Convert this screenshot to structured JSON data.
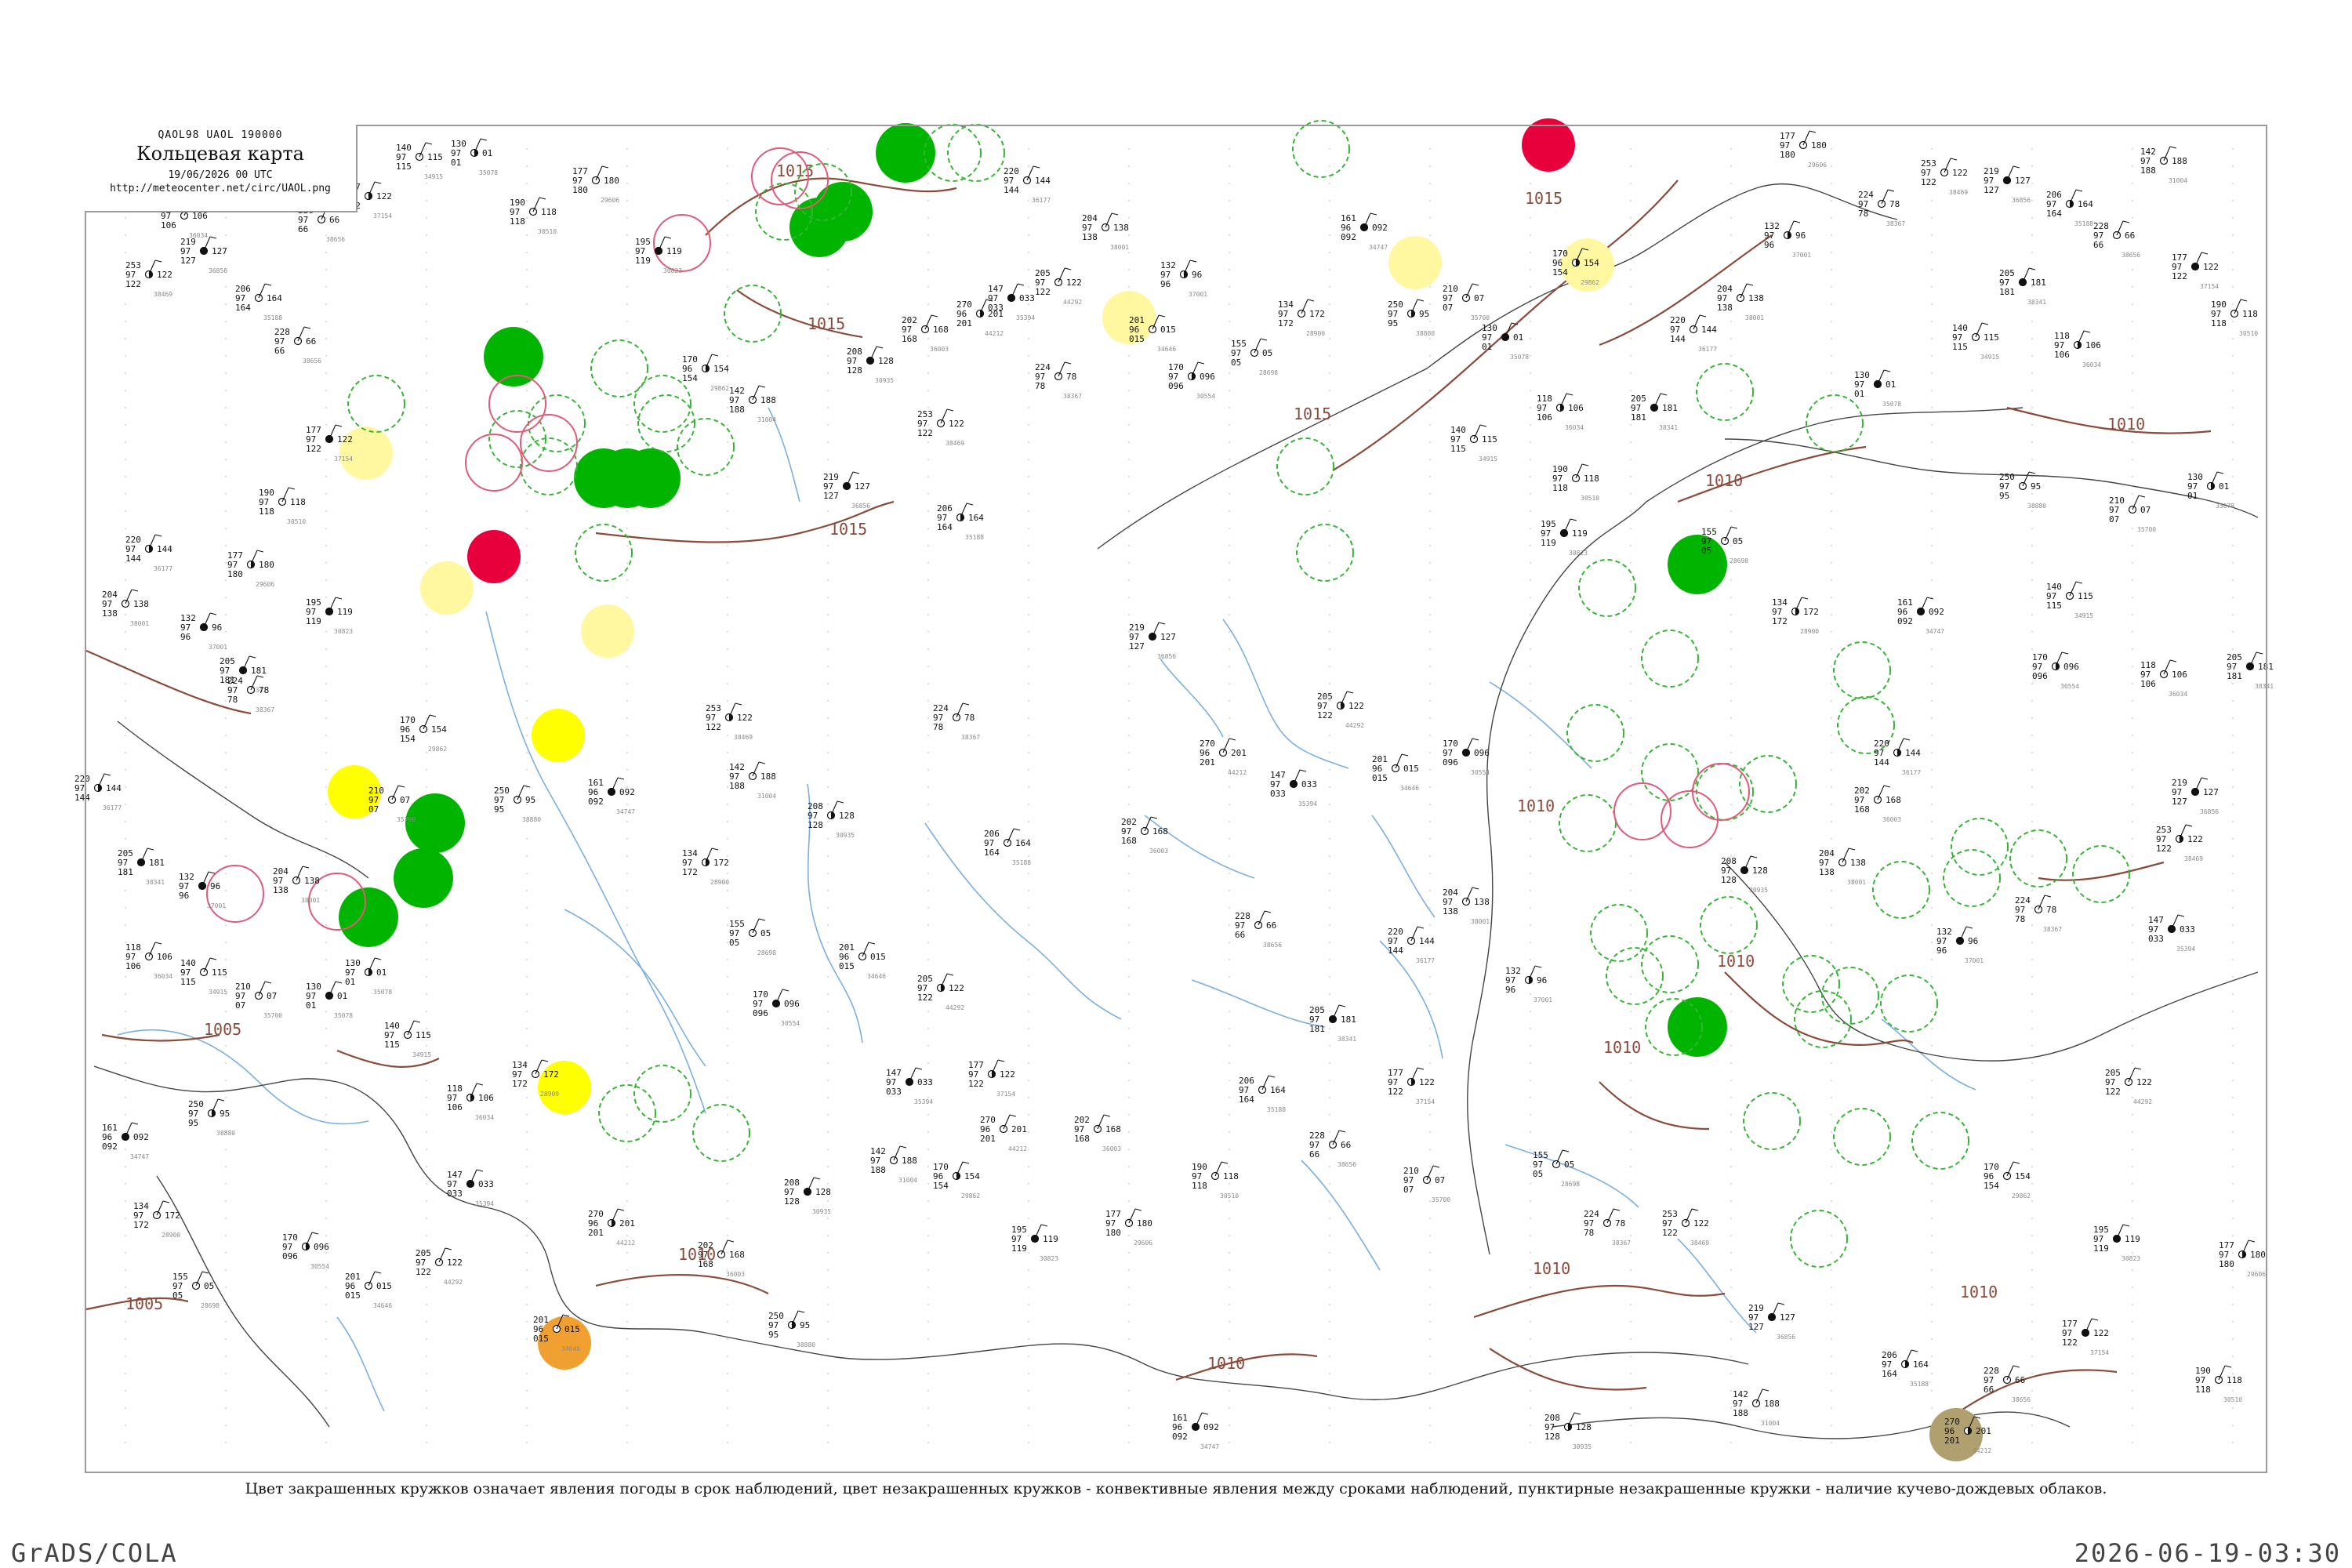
{
  "header": {
    "code_line": "QAOL98  UAOL  190000",
    "title": "Кольцевая карта",
    "datetime": "19/06/2026 00 UTC",
    "url": "http://meteocenter.net/circ/UAOL.png"
  },
  "caption": "Цвет закрашенных кружков означает явления погоды в срок наблюдений, цвет незакрашенных кружков - конвективные явления между сроками наблюдений, пунктирные незакрашенные кружки - наличие кучево-дождевых облаков.",
  "footer": {
    "left": "GrADS/COLA",
    "right": "2026-06-19-03:30"
  },
  "colors": {
    "rain": "#00b400",
    "thunder": "#e8003c",
    "haze": "#ffff00",
    "light_haze": "#fff8a0",
    "dust": "#f0a030",
    "fog": "#b0a070",
    "cb_dashed": "#34b534",
    "conv_open": "#e05a7a",
    "isobar": "#8b4a3a",
    "river": "#7ab0e0",
    "border": "#444444"
  },
  "isobar_labels": [
    "1015",
    "1015",
    "1015",
    "1015",
    "1015",
    "1010",
    "1010",
    "1010",
    "1010",
    "1010",
    "1010",
    "1010",
    "1005",
    "1005",
    "1010",
    "1010"
  ],
  "stations": [
    {
      "id": "35078",
      "t": "130",
      "p": "97",
      "v": "01"
    },
    {
      "id": "34915",
      "t": "140",
      "p": "97",
      "v": "115"
    },
    {
      "id": "36034",
      "t": "118",
      "p": "97",
      "v": "106"
    },
    {
      "id": "38341",
      "t": "205",
      "p": "97",
      "v": "181"
    },
    {
      "id": "36177",
      "t": "220",
      "p": "97",
      "v": "144"
    },
    {
      "id": "38001",
      "t": "204",
      "p": "97",
      "v": "138"
    },
    {
      "id": "37001",
      "t": "132",
      "p": "97",
      "v": "96"
    },
    {
      "id": "38367",
      "t": "224",
      "p": "97",
      "v": "78"
    },
    {
      "id": "38469",
      "t": "253",
      "p": "97",
      "v": "122"
    },
    {
      "id": "36856",
      "t": "219",
      "p": "97",
      "v": "127"
    },
    {
      "id": "35188",
      "t": "206",
      "p": "97",
      "v": "164"
    },
    {
      "id": "38656",
      "t": "228",
      "p": "97",
      "v": "66"
    },
    {
      "id": "37154",
      "t": "177",
      "p": "97",
      "v": "122"
    },
    {
      "id": "30510",
      "t": "190",
      "p": "97",
      "v": "118"
    },
    {
      "id": "29606",
      "t": "177",
      "p": "97",
      "v": "180"
    },
    {
      "id": "30823",
      "t": "195",
      "p": "97",
      "v": "119"
    },
    {
      "id": "29862",
      "t": "170",
      "p": "96",
      "v": "154"
    },
    {
      "id": "31004",
      "t": "142",
      "p": "97",
      "v": "188"
    },
    {
      "id": "30935",
      "t": "208",
      "p": "97",
      "v": "128"
    },
    {
      "id": "36003",
      "t": "202",
      "p": "97",
      "v": "168"
    },
    {
      "id": "44212",
      "t": "270",
      "p": "96",
      "v": "201"
    },
    {
      "id": "35394",
      "t": "147",
      "p": "97",
      "v": "033"
    },
    {
      "id": "44292",
      "t": "205",
      "p": "97",
      "v": "122"
    },
    {
      "id": "34646",
      "t": "201",
      "p": "96",
      "v": "015"
    },
    {
      "id": "30554",
      "t": "170",
      "p": "97",
      "v": "096"
    },
    {
      "id": "28698",
      "t": "155",
      "p": "97",
      "v": "05"
    },
    {
      "id": "28900",
      "t": "134",
      "p": "97",
      "v": "172"
    },
    {
      "id": "34747",
      "t": "161",
      "p": "96",
      "v": "092"
    },
    {
      "id": "38880",
      "t": "250",
      "p": "97",
      "v": "95"
    },
    {
      "id": "35700",
      "t": "210",
      "p": "97",
      "v": "07"
    }
  ]
}
